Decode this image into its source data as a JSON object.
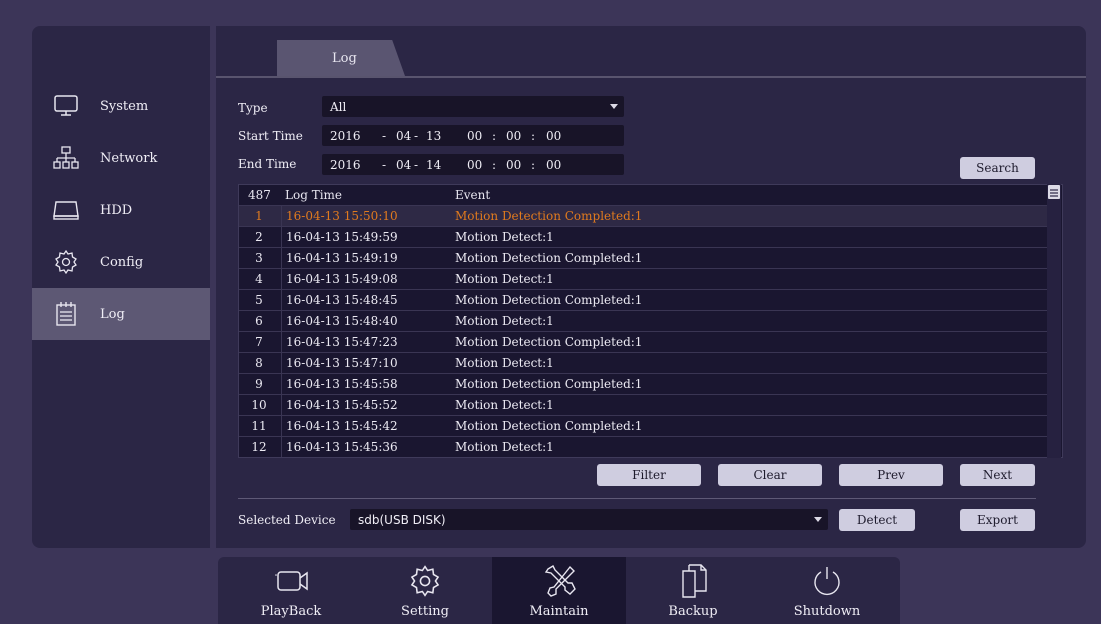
{
  "sidebar": {
    "items": [
      {
        "label": "System",
        "icon": "monitor-icon"
      },
      {
        "label": "Network",
        "icon": "network-icon"
      },
      {
        "label": "HDD",
        "icon": "hdd-icon"
      },
      {
        "label": "Config",
        "icon": "gear-icon"
      },
      {
        "label": "Log",
        "icon": "notepad-icon"
      }
    ],
    "active": "Log"
  },
  "tabs": [
    {
      "label": "Log"
    }
  ],
  "filters": {
    "type_label": "Type",
    "type_value": "All",
    "start_label": "Start Time",
    "start": {
      "year": "2016",
      "month": "04",
      "day": "13",
      "hh": "00",
      "mm": "00",
      "ss": "00"
    },
    "end_label": "End Time",
    "end": {
      "year": "2016",
      "month": "04",
      "day": "14",
      "hh": "00",
      "mm": "00",
      "ss": "00"
    },
    "date_sep": "-",
    "time_sep": ":",
    "search_label": "Search"
  },
  "log_table": {
    "count": "487",
    "col_time": "Log Time",
    "col_event": "Event",
    "rows": [
      {
        "idx": "1",
        "time": "16-04-13 15:50:10",
        "event": "Motion Detection Completed:1"
      },
      {
        "idx": "2",
        "time": "16-04-13 15:49:59",
        "event": "Motion Detect:1"
      },
      {
        "idx": "3",
        "time": "16-04-13 15:49:19",
        "event": "Motion Detection Completed:1"
      },
      {
        "idx": "4",
        "time": "16-04-13 15:49:08",
        "event": "Motion Detect:1"
      },
      {
        "idx": "5",
        "time": "16-04-13 15:48:45",
        "event": "Motion Detection Completed:1"
      },
      {
        "idx": "6",
        "time": "16-04-13 15:48:40",
        "event": "Motion Detect:1"
      },
      {
        "idx": "7",
        "time": "16-04-13 15:47:23",
        "event": "Motion Detection Completed:1"
      },
      {
        "idx": "8",
        "time": "16-04-13 15:47:10",
        "event": "Motion Detect:1"
      },
      {
        "idx": "9",
        "time": "16-04-13 15:45:58",
        "event": "Motion Detection Completed:1"
      },
      {
        "idx": "10",
        "time": "16-04-13 15:45:52",
        "event": "Motion Detect:1"
      },
      {
        "idx": "11",
        "time": "16-04-13 15:45:42",
        "event": "Motion Detection Completed:1"
      },
      {
        "idx": "12",
        "time": "16-04-13 15:45:36",
        "event": "Motion Detect:1"
      }
    ],
    "selected_row": "1",
    "highlight_color": "#e07a1e"
  },
  "actions": {
    "filter": "Filter",
    "clear": "Clear",
    "prev": "Prev",
    "next": "Next"
  },
  "device": {
    "label": "Selected Device",
    "value": "sdb(USB DISK)",
    "detect": "Detect",
    "export": "Export"
  },
  "dock": {
    "items": [
      {
        "label": "PlayBack",
        "icon": "camera-icon"
      },
      {
        "label": "Setting",
        "icon": "gear-icon"
      },
      {
        "label": "Maintain",
        "icon": "tools-icon"
      },
      {
        "label": "Backup",
        "icon": "copy-icon"
      },
      {
        "label": "Shutdown",
        "icon": "power-icon"
      }
    ],
    "active": "Maintain"
  }
}
